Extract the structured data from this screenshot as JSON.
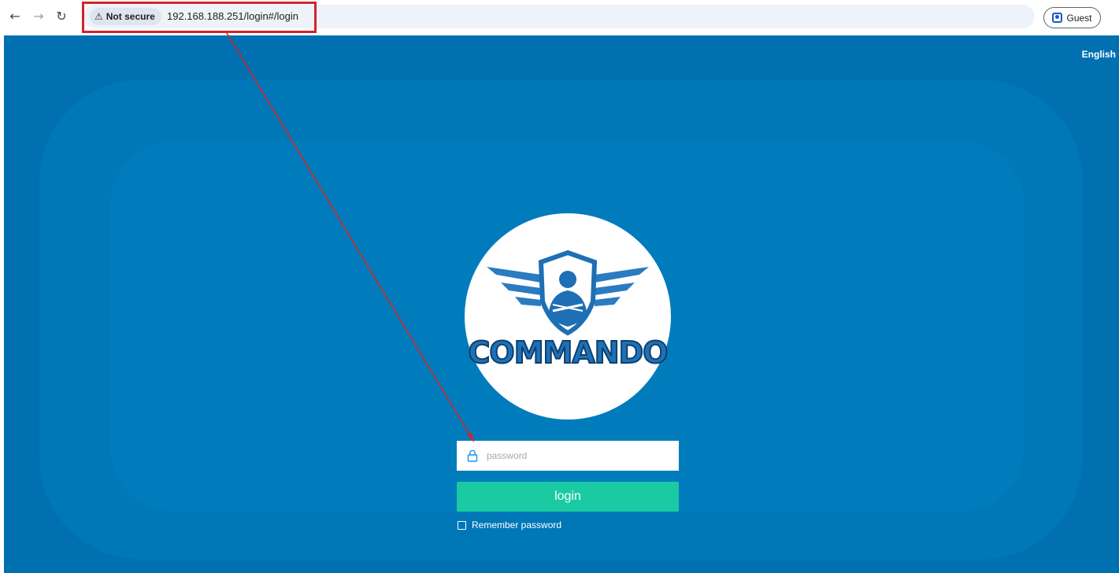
{
  "browser": {
    "security_label": "Not secure",
    "url": "192.168.188.251/login#/login",
    "profile_label": "Guest"
  },
  "page": {
    "language": "English",
    "logo_text": "COMMANDO",
    "password_placeholder": "password",
    "login_label": "login",
    "remember_label": "Remember password"
  },
  "colors": {
    "page_background": "#0070b1",
    "login_button": "#19caa2",
    "annotation": "#d3232a"
  }
}
